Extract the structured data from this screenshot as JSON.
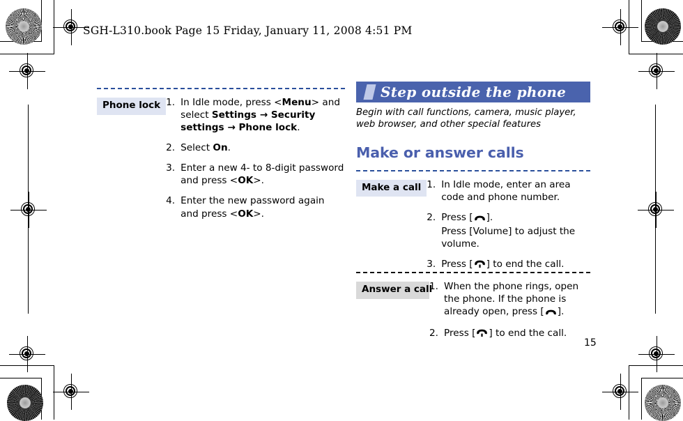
{
  "running_head": "SGH-L310.book  Page 15  Friday, January 11, 2008  4:51 PM",
  "page_number": "15",
  "colors": {
    "banner_bg": "#4a63ad",
    "banner_accent": "#bfc9e8",
    "heading": "#4a5fad",
    "rule_blue": "#2a4f9b",
    "rule_black": "#111111",
    "term_blue_bg": "#dfe4f2",
    "term_gray_bg": "#d9d9d9"
  },
  "left_column": {
    "entries": [
      {
        "term": "Phone lock",
        "term_style": "blue",
        "rule_style": "blue",
        "steps": [
          {
            "num": "1.",
            "parts": [
              {
                "t": "In Idle mode, press <",
                "b": false
              },
              {
                "t": "Menu",
                "b": true
              },
              {
                "t": "> and select ",
                "b": false
              },
              {
                "t": "Settings",
                "b": true
              },
              {
                "t": " → ",
                "b": true
              },
              {
                "t": "Security settings",
                "b": true
              },
              {
                "t": " → ",
                "b": true
              },
              {
                "t": "Phone lock",
                "b": true
              },
              {
                "t": ".",
                "b": false
              }
            ]
          },
          {
            "num": "2.",
            "parts": [
              {
                "t": "Select ",
                "b": false
              },
              {
                "t": "On",
                "b": true
              },
              {
                "t": ".",
                "b": false
              }
            ]
          },
          {
            "num": "3.",
            "parts": [
              {
                "t": "Enter a new 4- to 8-digit password and press <",
                "b": false
              },
              {
                "t": "OK",
                "b": true
              },
              {
                "t": ">.",
                "b": false
              }
            ]
          },
          {
            "num": "4.",
            "parts": [
              {
                "t": "Enter the new password again and press <",
                "b": false
              },
              {
                "t": "OK",
                "b": true
              },
              {
                "t": ">.",
                "b": false
              }
            ]
          }
        ]
      }
    ]
  },
  "right_column": {
    "banner_title": "Step outside the phone",
    "banner_subtitle": "Begin with call functions, camera, music player, web browser, and other special features",
    "section_heading": "Make or answer calls",
    "entries": [
      {
        "term": "Make a call",
        "term_style": "blue",
        "rule_style": "blue",
        "steps": [
          {
            "num": "1.",
            "parts": [
              {
                "t": "In Idle mode, enter an area code and phone number.",
                "b": false
              }
            ]
          },
          {
            "num": "2.",
            "parts": [
              {
                "t": "Press [",
                "b": false
              },
              {
                "icon": "send-key-icon"
              },
              {
                "t": "].",
                "b": false
              },
              {
                "br": true
              },
              {
                "t": "Press [Volume] to adjust the volume.",
                "b": false
              }
            ]
          },
          {
            "num": "3.",
            "parts": [
              {
                "t": "Press [",
                "b": false
              },
              {
                "icon": "end-key-icon"
              },
              {
                "t": "] to end the call.",
                "b": false
              }
            ]
          }
        ]
      },
      {
        "term": "Answer a call",
        "term_style": "gray",
        "rule_style": "black",
        "steps": [
          {
            "num": "1.",
            "parts": [
              {
                "t": "When the phone rings, open the phone. If the phone is already open, press [",
                "b": false
              },
              {
                "icon": "send-key-icon"
              },
              {
                "t": "].",
                "b": false
              }
            ]
          },
          {
            "num": "2.",
            "parts": [
              {
                "t": "Press [",
                "b": false
              },
              {
                "icon": "end-key-icon"
              },
              {
                "t": "] to end the call.",
                "b": false
              }
            ]
          }
        ]
      }
    ]
  },
  "print_marks": {
    "rosette_top_left": "rosette-icon",
    "rosette_top_right": "rosette-icon",
    "rosette_bottom_left": "rosette-icon",
    "rosette_bottom_right": "rosette-icon",
    "registration_targets": "registration-target-icon"
  }
}
